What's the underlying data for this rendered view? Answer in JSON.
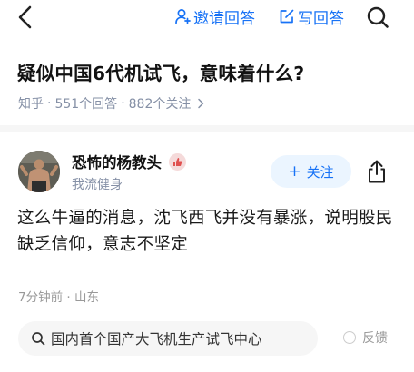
{
  "topbar": {
    "invite_label": "邀请回答",
    "write_label": "写回答"
  },
  "question": {
    "title": "疑似中国6代机试飞，意味着什么?",
    "source": "知乎",
    "answers": "551个回答",
    "followers": "882个关注",
    "separator": "·"
  },
  "answer": {
    "author_name": "恐怖的杨教头",
    "author_bio": "我流健身",
    "follow_label": "关注",
    "follow_prefix": "+",
    "text": "这么牛逼的消息，沈飞西飞并没有暴涨，说明股民缺乏信仰，意志不坚定",
    "meta": "7分钟前 · 山东"
  },
  "related": {
    "query": "国内首个国产大飞机生产试飞中心",
    "feedback_label": "反馈"
  },
  "colors": {
    "accent": "#1772f6",
    "meta_gray": "#8590a6",
    "follow_bg": "#ebf5ff",
    "chip_bg": "#f6f6f6"
  }
}
